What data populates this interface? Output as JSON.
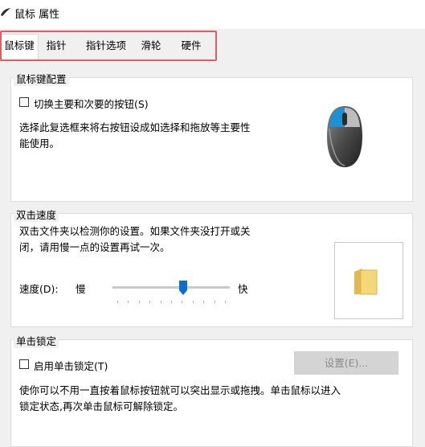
{
  "window": {
    "title": "鼠标 属性"
  },
  "tabs": [
    {
      "label": "鼠标键"
    },
    {
      "label": "指针"
    },
    {
      "label": "指针选项"
    },
    {
      "label": "滑轮"
    },
    {
      "label": "硬件"
    }
  ],
  "button_config": {
    "group_title": "鼠标键配置",
    "checkbox_label": "切换主要和次要的按钮(S)",
    "checked": false,
    "description_line1": "选择此复选框来将右按钮设成如选择和拖放等主要性",
    "description_line2": "能使用。"
  },
  "double_click": {
    "group_title": "双击速度",
    "description_line1": "双击文件夹以检测你的设置。如果文件夹没打开或关",
    "description_line2": "闭，请用慢一点的设置再试一次。",
    "speed_label": "速度(D):",
    "slow_label": "慢",
    "fast_label": "快",
    "speed_fraction": 0.6
  },
  "click_lock": {
    "group_title": "单击锁定",
    "checkbox_label": "启用单击锁定(T)",
    "checked": false,
    "settings_button": "设置(E)...",
    "description_line1": "使你可以不用一直按着鼠标按钮就可以突出显示或拖拽。单击鼠标以进入",
    "description_line2": "锁定状态,再次单击鼠标可解除锁定。"
  },
  "colors": {
    "highlight_box": "#e35b63",
    "mouse_button_accent": "#1e90d8"
  },
  "icons": [
    "mouse-window-icon",
    "mouse-illustration-icon",
    "folder-icon",
    "slider-thumb-icon"
  ]
}
